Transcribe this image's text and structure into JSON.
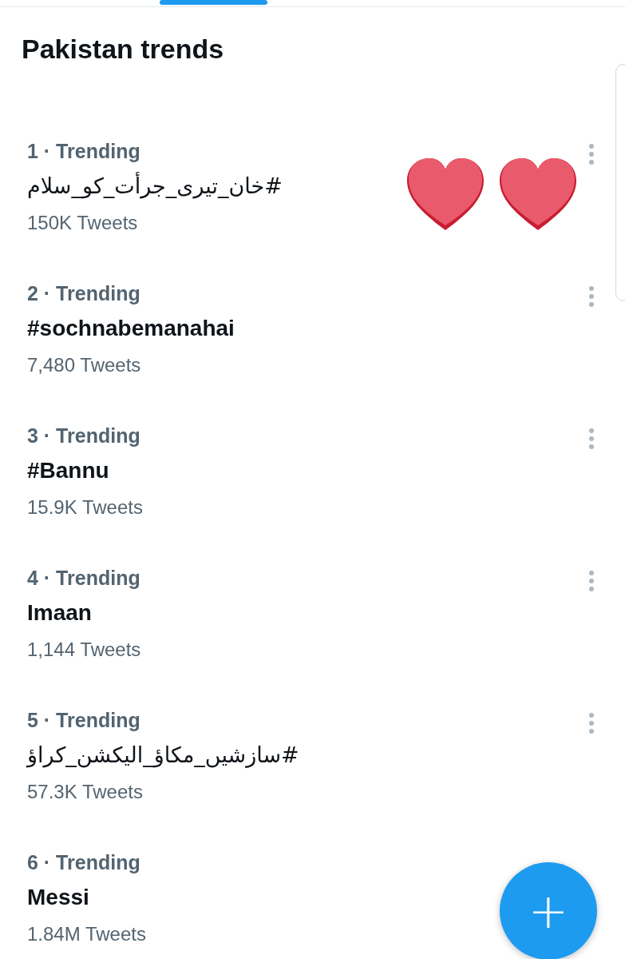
{
  "title": "Pakistan trends",
  "trends": [
    {
      "context": "1 · Trending",
      "name": "#خان_تیری_جرأت_کو_سلام",
      "count": "150K Tweets"
    },
    {
      "context": "2 · Trending",
      "name": "#sochnabemanahai",
      "count": "7,480 Tweets"
    },
    {
      "context": "3 · Trending",
      "name": "#Bannu",
      "count": "15.9K Tweets"
    },
    {
      "context": "4 · Trending",
      "name": "Imaan",
      "count": "1,144 Tweets"
    },
    {
      "context": "5 · Trending",
      "name": "#سازشیں_مکاؤ_الیکشن_کراؤ",
      "count": "57.3K Tweets"
    },
    {
      "context": "6 · Trending",
      "name": "Messi",
      "count": "1.84M Tweets"
    }
  ],
  "fab": "+"
}
